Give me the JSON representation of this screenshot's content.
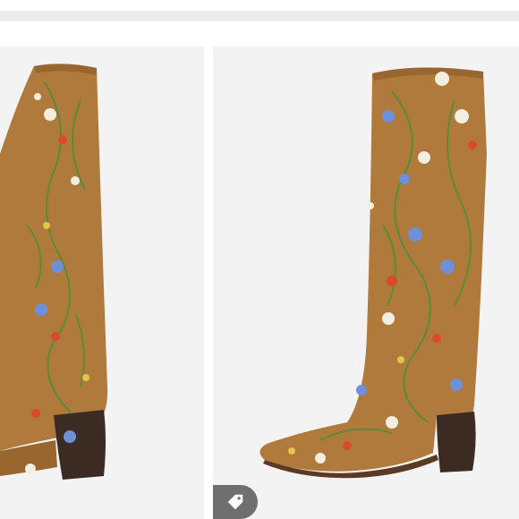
{
  "image": {
    "description_tags": [
      "boot-left-rear-view",
      "boot-right-side-view"
    ],
    "colors": {
      "suede": "#b07a3c",
      "heel": "#3b2b22",
      "panel_bg": "#f3f3f3",
      "badge": "#6f6f6f"
    },
    "icons": {
      "tag_badge": "price-tag-icon"
    }
  }
}
